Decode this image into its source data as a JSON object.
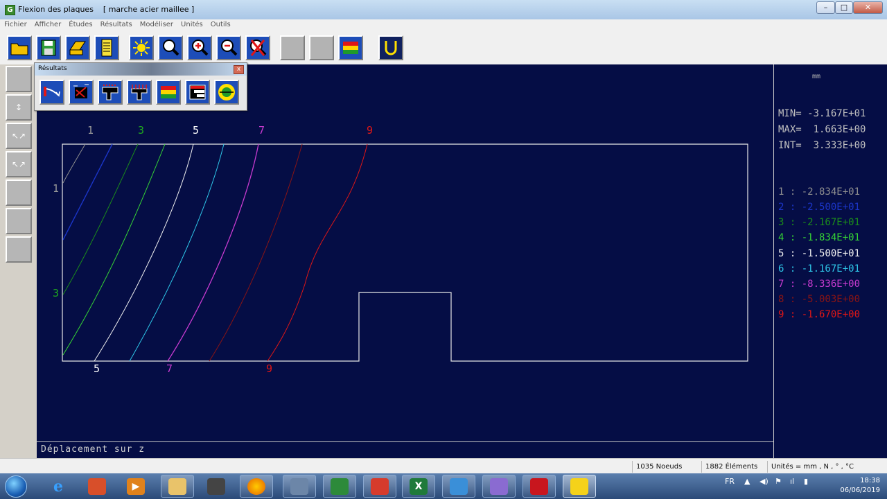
{
  "window": {
    "title": "Flexion des plaques    [ marche acier maillee ]",
    "controls": {
      "minimize": "–",
      "maximize": "□",
      "close": "✕"
    }
  },
  "menu": [
    "Fichier",
    "Afficher",
    "Études",
    "Résultats",
    "Modéliser",
    "Unités",
    "Outils"
  ],
  "toolbar_icons": [
    "open-folder-icon",
    "save-disk-icon",
    "print-icon",
    "notepad-icon",
    "light-icon",
    "zoom-icon",
    "zoom-in-icon",
    "zoom-out-icon",
    "zoom-cancel-icon",
    "blank-icon",
    "blank-icon",
    "color-scale-icon",
    "u-shape-icon"
  ],
  "results_palette": {
    "title": "Résultats",
    "close": "x",
    "icons": [
      "deflection-icon",
      "stress-arrows-icon",
      "moment-icon",
      "load-icon",
      "color-map-icon",
      "contour-bars-icon",
      "circle-cross-icon"
    ]
  },
  "canvas": {
    "contour_labels_top": [
      {
        "text": "1",
        "color": "#9a9a9a"
      },
      {
        "text": "3",
        "color": "#1fa81f"
      },
      {
        "text": "5",
        "color": "#ffffff"
      },
      {
        "text": "7",
        "color": "#c83bd0"
      },
      {
        "text": "9",
        "color": "#e01616"
      }
    ],
    "contour_labels_left": [
      {
        "text": "1",
        "color": "#9a9a9a"
      },
      {
        "text": "3",
        "color": "#1fa81f"
      }
    ],
    "contour_labels_bottom": [
      {
        "text": "5",
        "color": "#ffffff"
      },
      {
        "text": "7",
        "color": "#c83bd0"
      },
      {
        "text": "9",
        "color": "#e01616"
      }
    ],
    "status_text": "Déplacement sur z"
  },
  "side_panel": {
    "unit": "mm",
    "min": "MIN= -3.167E+01",
    "max": "MAX=  1.663E+00",
    "int": "INT=  3.333E+00",
    "legend": [
      {
        "label": "1 : -2.834E+01",
        "color": "#8f8f8f"
      },
      {
        "label": "2 : -2.500E+01",
        "color": "#1b35c8"
      },
      {
        "label": "3 : -2.167E+01",
        "color": "#1b8c1b"
      },
      {
        "label": "4 : -1.834E+01",
        "color": "#35d435"
      },
      {
        "label": "5 : -1.500E+01",
        "color": "#f0f0f0"
      },
      {
        "label": "6 : -1.167E+01",
        "color": "#2ec6e8"
      },
      {
        "label": "7 : -8.336E+00",
        "color": "#c83bd0"
      },
      {
        "label": "8 : -5.003E+00",
        "color": "#8a1414"
      },
      {
        "label": "9 : -1.670E+00",
        "color": "#e01616"
      }
    ]
  },
  "statusbar": {
    "nodes": "1035 Noeuds",
    "elements": "1882 Éléments",
    "units": "Unités = mm , N , ° , °C"
  },
  "taskbar": {
    "apps": [
      "ie-icon",
      "app-icon",
      "media-player-icon",
      "file-explorer-icon",
      "speakers-icon",
      "firefox-icon",
      "calculator-icon",
      "beam-app-icon",
      "sketchup-icon",
      "excel-icon",
      "notebook-icon",
      "paint-icon",
      "pdf-icon",
      "truss-app-icon"
    ],
    "lang": "FR",
    "time": "18:38",
    "date": "06/06/2019"
  }
}
